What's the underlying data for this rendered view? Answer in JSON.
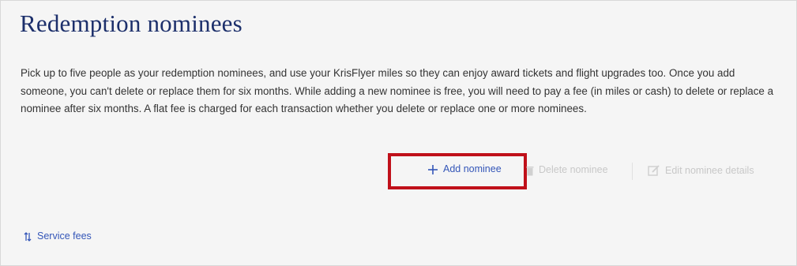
{
  "page": {
    "title": "Redemption nominees",
    "description": "Pick up to five people as your redemption nominees, and use your KrisFlyer miles so they can enjoy award tickets and flight upgrades too. Once you add someone, you can't delete or replace them for six months. While adding a new nominee is free, you will need to pay a fee (in miles or cash) to delete or replace a nominee after six months. A flat fee is charged for each transaction whether you delete or replace one or more nominees."
  },
  "actions": {
    "add_label": "Add nominee",
    "add_icon": "plus-icon",
    "delete_label": "Delete nominee",
    "delete_icon": "trash-icon",
    "edit_label": "Edit nominee details",
    "edit_icon": "edit-icon"
  },
  "links": {
    "service_fees_label": "Service fees",
    "service_fees_icon": "sort-arrows-icon"
  },
  "colors": {
    "title": "#1c2f6b",
    "link": "#3456b8",
    "disabled": "#c8c8c8",
    "highlight": "#c0101a",
    "background": "#f5f5f5"
  }
}
